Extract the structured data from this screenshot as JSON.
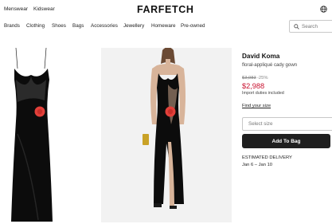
{
  "header": {
    "gender_links": [
      "Menswear",
      "Kidswear"
    ],
    "logo": "FARFETCH"
  },
  "categories": [
    "Brands",
    "Clothing",
    "Shoes",
    "Bags",
    "Accessories",
    "Jewellery",
    "Homeware",
    "Pre-owned"
  ],
  "search": {
    "placeholder": "Search"
  },
  "product": {
    "brand": "David Koma",
    "name": "floral-appliqué cady gown",
    "original_price": "$3,983",
    "discount": "-25%",
    "price": "$2,988",
    "duties_note": "Import duties included",
    "size_guide_link": "Find your size",
    "size_select_placeholder": "Select size",
    "add_to_bag_label": "Add To Bag",
    "delivery_label": "ESTIMATED DELIVERY",
    "delivery_dates": "Jan 6 – Jan 10"
  },
  "colors": {
    "accent_price": "#c8102e",
    "dress": "#0c0c0c",
    "flower": "#e2403a",
    "button_bg": "#1f1f1f"
  }
}
